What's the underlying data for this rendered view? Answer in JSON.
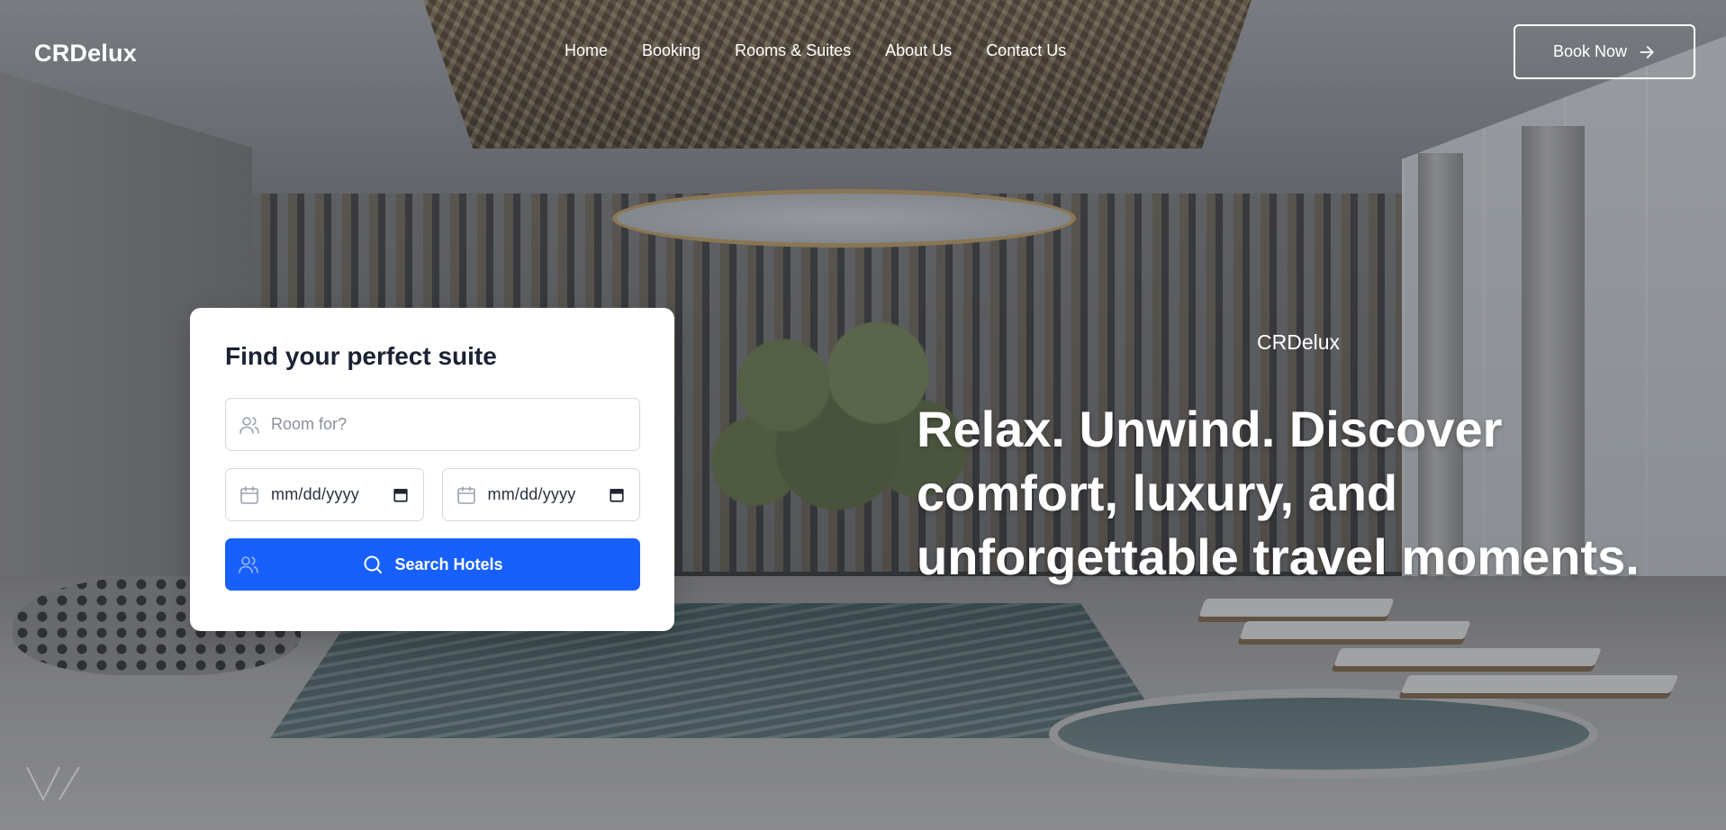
{
  "header": {
    "brand": "CRDelux",
    "nav": [
      "Home",
      "Booking",
      "Rooms & Suites",
      "About Us",
      "Contact Us"
    ],
    "book_label": "Book Now",
    "book_icon": "arrow-right-icon"
  },
  "search": {
    "title": "Find your perfect suite",
    "room_placeholder": "Room for?",
    "room_icon": "users-icon",
    "checkin_value": "mm/dd/yyyy",
    "checkout_value": "mm/dd/yyyy",
    "date_icon": "calendar-icon",
    "button_label": "Search Hotels",
    "button_icon": "search-icon",
    "accent_color": "#1760fb"
  },
  "hero": {
    "brand": "CRDelux",
    "title": "Relax. Unwind. Discover comfort, luxury, and unforgettable travel moments."
  }
}
